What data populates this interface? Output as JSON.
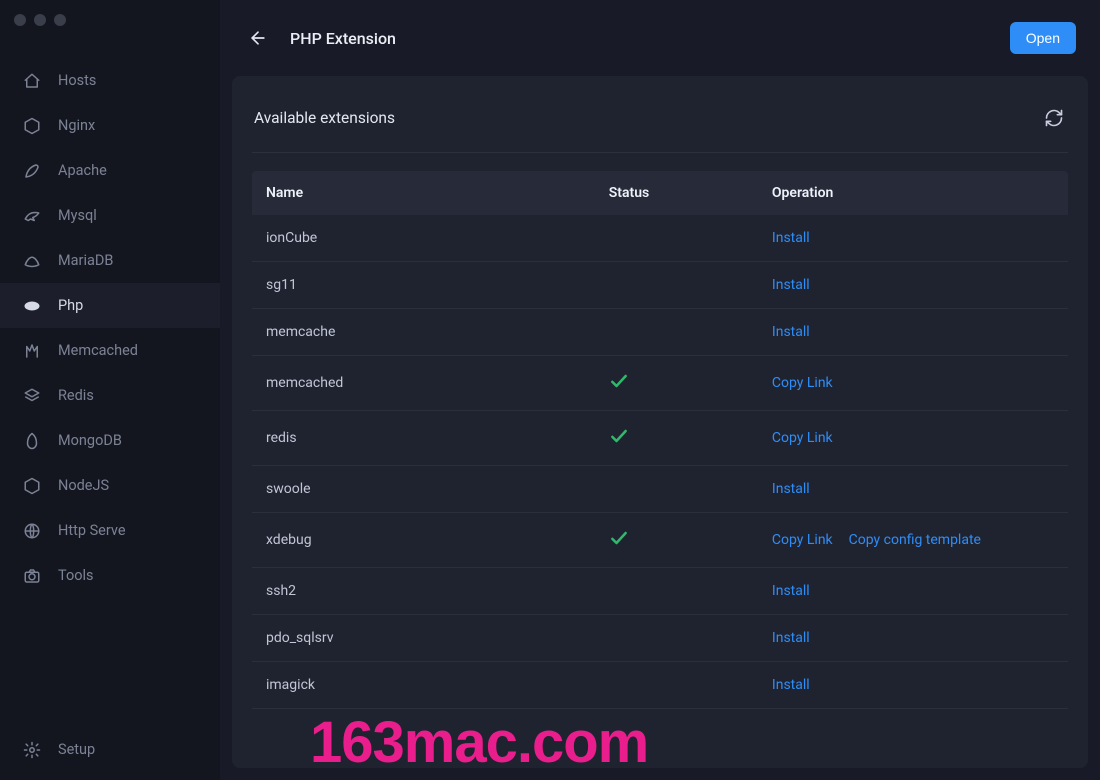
{
  "colors": {
    "accent": "#2f8df7",
    "success": "#2fb96b",
    "watermark": "#e91e8c"
  },
  "header": {
    "title": "PHP Extension",
    "open_label": "Open"
  },
  "panel": {
    "title": "Available extensions"
  },
  "sidebar": {
    "items": [
      {
        "label": "Hosts",
        "icon": "home-icon"
      },
      {
        "label": "Nginx",
        "icon": "nginx-icon"
      },
      {
        "label": "Apache",
        "icon": "feather-icon"
      },
      {
        "label": "Mysql",
        "icon": "dolphin-icon"
      },
      {
        "label": "MariaDB",
        "icon": "seal-icon"
      },
      {
        "label": "Php",
        "icon": "php-icon"
      },
      {
        "label": "Memcached",
        "icon": "memcached-icon"
      },
      {
        "label": "Redis",
        "icon": "layers-icon"
      },
      {
        "label": "MongoDB",
        "icon": "leaf-icon"
      },
      {
        "label": "NodeJS",
        "icon": "node-icon"
      },
      {
        "label": "Http Serve",
        "icon": "globe-icon"
      },
      {
        "label": "Tools",
        "icon": "camera-icon"
      }
    ],
    "bottom": {
      "label": "Setup",
      "icon": "gear-icon"
    },
    "active_index": 5
  },
  "table": {
    "columns": {
      "name": "Name",
      "status": "Status",
      "operation": "Operation"
    },
    "actions": {
      "install": "Install",
      "copy_link": "Copy Link",
      "copy_config": "Copy config template"
    },
    "rows": [
      {
        "name": "ionCube",
        "installed": false,
        "ops": [
          "install"
        ]
      },
      {
        "name": "sg11",
        "installed": false,
        "ops": [
          "install"
        ]
      },
      {
        "name": "memcache",
        "installed": false,
        "ops": [
          "install"
        ]
      },
      {
        "name": "memcached",
        "installed": true,
        "ops": [
          "copy_link"
        ]
      },
      {
        "name": "redis",
        "installed": true,
        "ops": [
          "copy_link"
        ]
      },
      {
        "name": "swoole",
        "installed": false,
        "ops": [
          "install"
        ]
      },
      {
        "name": "xdebug",
        "installed": true,
        "ops": [
          "copy_link",
          "copy_config"
        ]
      },
      {
        "name": "ssh2",
        "installed": false,
        "ops": [
          "install"
        ]
      },
      {
        "name": "pdo_sqlsrv",
        "installed": false,
        "ops": [
          "install"
        ]
      },
      {
        "name": "imagick",
        "installed": false,
        "ops": [
          "install"
        ]
      }
    ]
  },
  "watermark": "163mac.com"
}
